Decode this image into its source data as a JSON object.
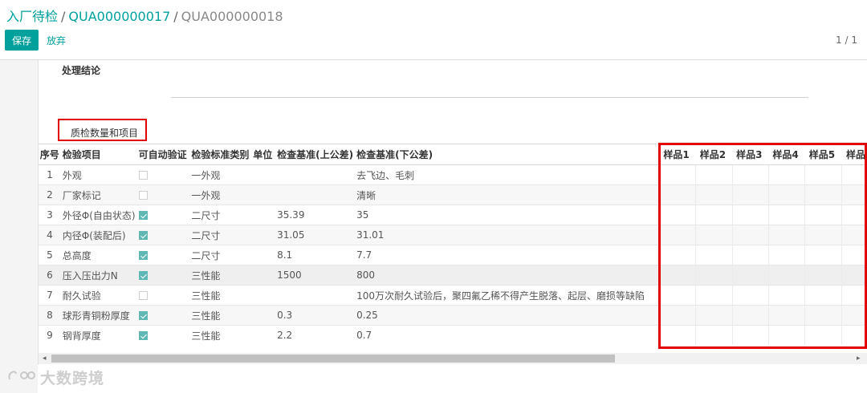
{
  "breadcrumb": {
    "first": "入厂待检",
    "second": "QUA000000017",
    "current": "QUA000000018",
    "separator": "/"
  },
  "toolbar": {
    "save_label": "保存",
    "discard_label": "放弃",
    "pager": "1 / 1"
  },
  "form": {
    "section_title": "处理结论",
    "tab_label": "质检数量和项目"
  },
  "table": {
    "headers": {
      "index": "序号",
      "item": "检验项目",
      "auto": "可自动验证",
      "category": "检验标准类别",
      "unit": "单位",
      "upper": "检查基准(上公差)",
      "lower": "检查基准(下公差)",
      "s1": "样品1",
      "s2": "样品2",
      "s3": "样品3",
      "s4": "样品4",
      "s5": "样品5",
      "s6": "样品"
    },
    "rows": [
      {
        "index": "1",
        "item": "外观",
        "auto": false,
        "category": "一外观",
        "unit": "",
        "upper": "",
        "lower": "去飞边、毛刺"
      },
      {
        "index": "2",
        "item": "厂家标记",
        "auto": false,
        "category": "一外观",
        "unit": "",
        "upper": "",
        "lower": "清晰"
      },
      {
        "index": "3",
        "item": "外径Φ(自由状态)",
        "auto": true,
        "category": "二尺寸",
        "unit": "",
        "upper": "35.39",
        "lower": "35"
      },
      {
        "index": "4",
        "item": "内径Φ(装配后)",
        "auto": true,
        "category": "二尺寸",
        "unit": "",
        "upper": "31.05",
        "lower": "31.01"
      },
      {
        "index": "5",
        "item": "总高度",
        "auto": true,
        "category": "二尺寸",
        "unit": "",
        "upper": "8.1",
        "lower": "7.7"
      },
      {
        "index": "6",
        "item": "压入压出力N",
        "auto": true,
        "category": "三性能",
        "unit": "",
        "upper": "1500",
        "lower": "800"
      },
      {
        "index": "7",
        "item": "耐久试验",
        "auto": false,
        "category": "三性能",
        "unit": "",
        "upper": "",
        "lower": "100万次耐久试验后，聚四氟乙稀不得产生脱落、起层、磨损等缺陷"
      },
      {
        "index": "8",
        "item": "球形青铜粉厚度",
        "auto": true,
        "category": "三性能",
        "unit": "",
        "upper": "0.3",
        "lower": "0.25"
      },
      {
        "index": "9",
        "item": "钢背厚度",
        "auto": true,
        "category": "三性能",
        "unit": "",
        "upper": "2.2",
        "lower": "0.7"
      }
    ]
  },
  "scrollbar": {
    "left_arrow": "◂",
    "right_arrow": "▸"
  },
  "watermark": {
    "text": "大数跨境"
  },
  "colors": {
    "accent": "#00A09D",
    "highlight_box": "#e00000",
    "checkbox_on": "#5fb8b4"
  }
}
